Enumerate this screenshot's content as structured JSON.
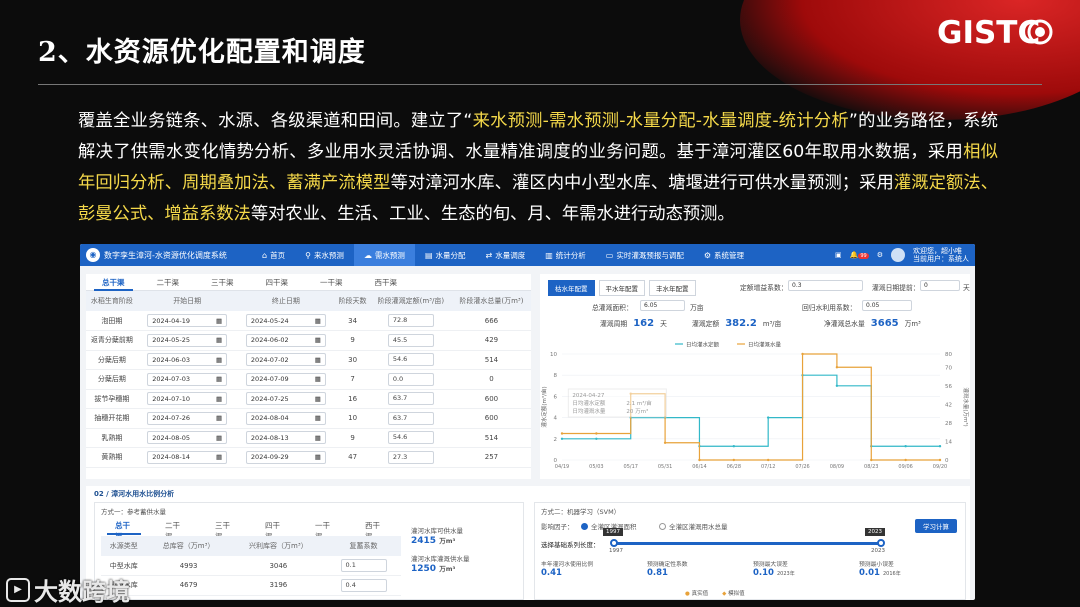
{
  "slide": {
    "title": "2、水资源优化配置和调度",
    "logo_text": "GISTC",
    "para": [
      {
        "t": "覆盖全业务链条、水源、各级渠道和田间。建立了“",
        "hl": false
      },
      {
        "t": "来水预测-需水预测-水量分配-水量调度-统计分析",
        "hl": true
      },
      {
        "t": "”的业务路径，系统解决了供需水变化情势分析、多业用水灵活协调、水量精准调度的业务问题。基于漳河灌区60年取用水数据，采用",
        "hl": false
      },
      {
        "t": "相似年回归分析、周期叠加法、蓄满产流模型",
        "hl": true
      },
      {
        "t": "等对漳河水库、灌区内中小型水库、塘堰进行可供水量预测；采用",
        "hl": false
      },
      {
        "t": "灌溉定额法、彭曼公式、增益系数法",
        "hl": true
      },
      {
        "t": "等对农业、生活、工业、生态的旬、月、年需水进行动态预测。",
        "hl": false
      }
    ],
    "watermark": "大数跨境",
    "accent": "#f5d94a"
  },
  "app": {
    "title": "数字孪生漳河-水资源优化调度系统",
    "nav": [
      {
        "icon": "⌂",
        "label": "首页"
      },
      {
        "icon": "⚲",
        "label": "来水预测"
      },
      {
        "icon": "☁",
        "label": "需水预测",
        "active": true
      },
      {
        "icon": "▤",
        "label": "水量分配"
      },
      {
        "icon": "⇄",
        "label": "水量调度"
      },
      {
        "icon": "▥",
        "label": "统计分析"
      },
      {
        "icon": "▭",
        "label": "实时灌溉预报与调配"
      },
      {
        "icon": "⚙",
        "label": "系统管理"
      }
    ],
    "badge": "99",
    "user_line1": "欢迎您，超小唯",
    "user_line2": "当前用户：系统人",
    "brand_color": "#1d63c4"
  },
  "left": {
    "tabs": [
      "总干渠",
      "二干渠",
      "三干渠",
      "四干渠",
      "一干渠",
      "西干渠"
    ],
    "headers": [
      "水稻生育阶段",
      "开始日期",
      "终止日期",
      "阶段天数",
      "阶段灌溉定额(m³/亩)",
      "阶段灌水总量(万m³)"
    ],
    "rows": [
      [
        "泡田期",
        "2024-04-19",
        "2024-05-24",
        "34",
        "72.8",
        "666"
      ],
      [
        "返青分蘖前期",
        "2024-05-25",
        "2024-06-02",
        "9",
        "45.5",
        "429"
      ],
      [
        "分蘖后期",
        "2024-06-03",
        "2024-07-02",
        "30",
        "54.6",
        "514"
      ],
      [
        "分蘖后期",
        "2024-07-03",
        "2024-07-09",
        "7",
        "0.0",
        "0"
      ],
      [
        "拔节孕穗期",
        "2024-07-10",
        "2024-07-25",
        "16",
        "63.7",
        "600"
      ],
      [
        "抽穗开花期",
        "2024-07-26",
        "2024-08-04",
        "10",
        "63.7",
        "600"
      ],
      [
        "乳熟期",
        "2024-08-05",
        "2024-08-13",
        "9",
        "54.6",
        "514"
      ],
      [
        "黄熟期",
        "2024-08-14",
        "2024-09-29",
        "47",
        "27.3",
        "257"
      ]
    ]
  },
  "right": {
    "tabs": [
      "枯水年配置",
      "平水年配置",
      "丰水年配置"
    ],
    "efficiency_label": "定额增益系数：",
    "efficiency_value": "0.3",
    "advance_label": "灌溉日期提前：",
    "advance_value": "0",
    "advance_unit": "天",
    "area_label": "总灌溉面积：",
    "area_value": "6.05",
    "area_unit": "万亩",
    "reuse_label": "回归水利用系数：",
    "reuse_value": "0.05",
    "stat1_label": "灌溉周期",
    "stat1_value": "162",
    "stat1_unit": "天",
    "stat2_label": "灌溉定额",
    "stat2_value": "382.2",
    "stat2_unit": "m³/亩",
    "stat3_label": "净灌溉总水量",
    "stat3_value": "3665",
    "stat3_unit": "万m³",
    "tooltip_date": "2024-04-27",
    "tooltip_a": "2.1 m³/亩",
    "tooltip_b": "20 万m³"
  },
  "chart_data": {
    "type": "line",
    "x": [
      "04/19",
      "05/03",
      "05/17",
      "05/31",
      "06/14",
      "06/28",
      "07/12",
      "07/26",
      "08/09",
      "08/23",
      "09/06",
      "09/20"
    ],
    "series": [
      {
        "name": "日均灌水定额",
        "axis": "left",
        "color": "#32b8c8",
        "values": [
          2,
          2,
          4,
          4,
          1.3,
          1.3,
          4,
          8,
          7,
          1.3,
          1.3,
          1.3
        ]
      },
      {
        "name": "日均灌溉水量",
        "axis": "right",
        "color": "#e8a23a",
        "values": [
          20,
          20,
          50,
          13,
          0,
          0,
          0,
          80,
          70,
          0,
          0,
          0
        ]
      }
    ],
    "ylim": [
      0,
      10
    ],
    "y2lim": [
      0,
      80
    ],
    "ylabel": "灌水定额(m³/亩)",
    "y2label": "灌溉水量(万m³)",
    "yticks": [
      0,
      2,
      4,
      6,
      8,
      10
    ],
    "y2ticks": [
      0,
      14,
      28,
      42,
      56,
      70,
      80
    ]
  },
  "bottom": {
    "section_title": "02 / 漳河水用水比例分析",
    "left_method": "方式一：参考蓄供水量",
    "left_tabs": [
      "总干渠",
      "二干渠",
      "三干渠",
      "四干渠",
      "一干渠",
      "西干渠"
    ],
    "left_headers": [
      "水源类型",
      "总库容（万m³）",
      "兴利库容（万m³）",
      "复蓄系数"
    ],
    "left_rows": [
      [
        "中型水库",
        "4993",
        "3046",
        "0.1"
      ],
      [
        "小型水库",
        "4679",
        "3196",
        "0.4"
      ]
    ],
    "kpi1_label": "灌河水库可供水量",
    "kpi1_value": "2415",
    "kpi1_unit": "万m³",
    "kpi2_label": "灌河水库灌溉供水量",
    "kpi2_value": "1250",
    "kpi2_unit": "万m³",
    "right_method": "方式二：机器学习（SVM）",
    "factor_label": "影响因子：",
    "factor_opt1": "全灌区灌溉面积",
    "factor_opt2": "全灌区灌溉用水总量",
    "train_button": "学习计算",
    "slider_label": "选择基础系列长度：",
    "slider_left": "1997",
    "slider_right": "2023",
    "slider_tip_left": "1997",
    "slider_tip_right": "2023",
    "m_labels": [
      "丰年灌河水使用比例",
      "预测确定性系数",
      "预测最大误差",
      "预测最小误差"
    ],
    "m_values": [
      "0.41",
      "0.81",
      "0.10",
      "0.01"
    ],
    "m_sub": [
      "",
      "",
      "2023年",
      "2016年"
    ],
    "legend": [
      "真实值",
      "模拟值"
    ]
  }
}
